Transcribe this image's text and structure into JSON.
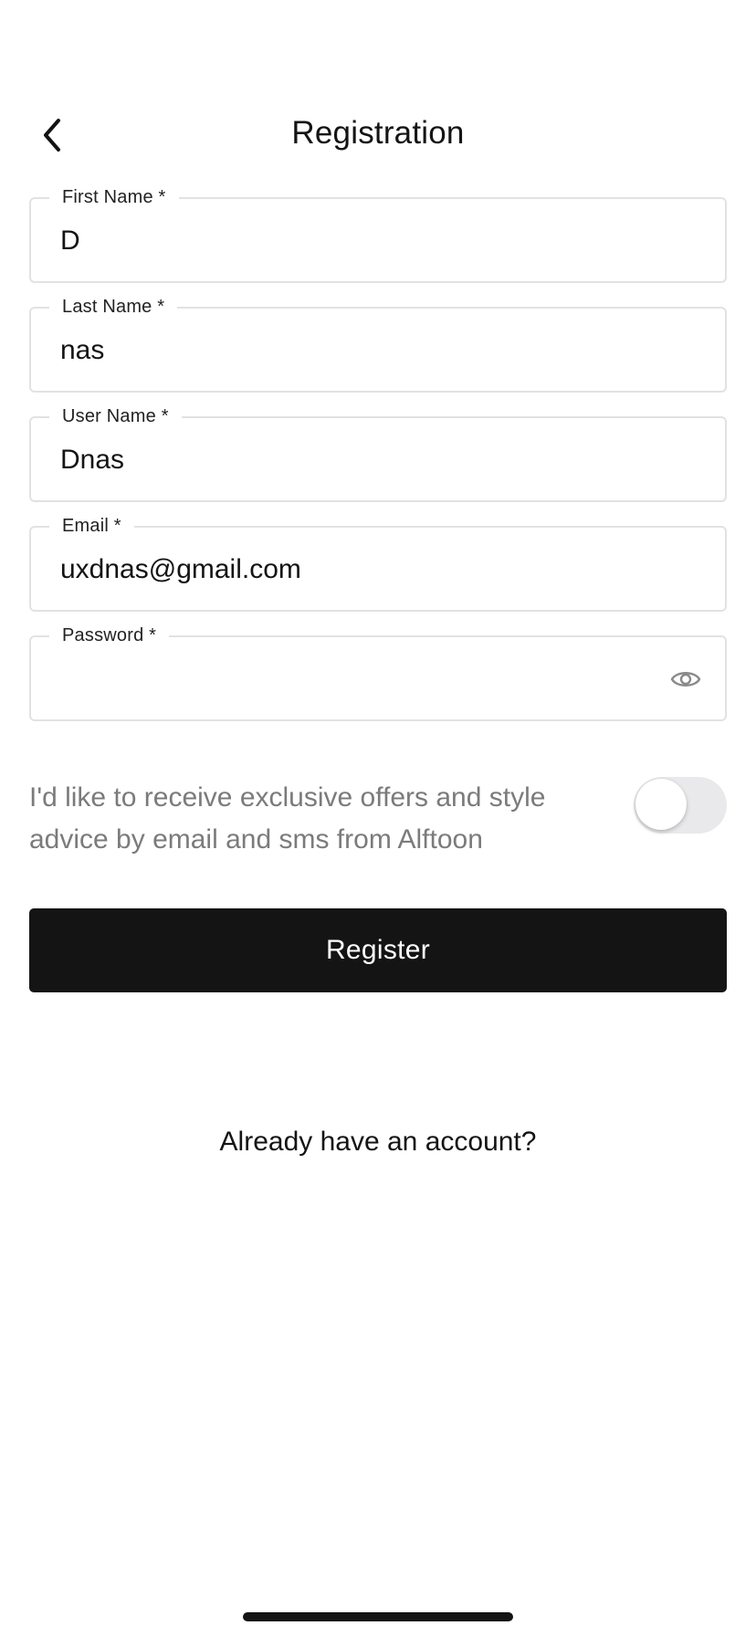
{
  "header": {
    "title": "Registration",
    "back_icon": "chevron-left-icon"
  },
  "form": {
    "first_name": {
      "label": "First Name *",
      "value": "D"
    },
    "last_name": {
      "label": "Last Name *",
      "value": "nas"
    },
    "user_name": {
      "label": "User Name *",
      "value": "Dnas"
    },
    "email": {
      "label": "Email *",
      "value": "uxdnas@gmail.com"
    },
    "password": {
      "label": "Password *",
      "value": "",
      "toggle_icon": "eye-icon"
    }
  },
  "opt_in": {
    "text": "I'd like to receive exclusive offers and style advice by email and sms from Alftoon",
    "enabled": false
  },
  "actions": {
    "register_label": "Register",
    "login_link": "Already have an account?"
  },
  "colors": {
    "primary": "#141414",
    "border": "#e2e2e2",
    "muted_text": "#7b7b7b",
    "toggle_off": "#e9e9eb"
  }
}
